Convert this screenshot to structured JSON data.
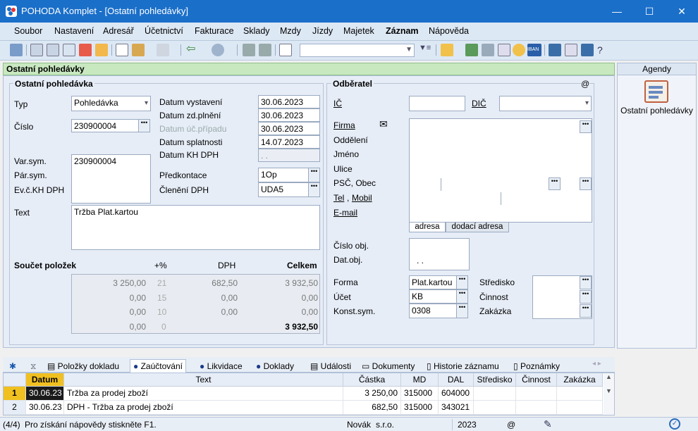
{
  "window": {
    "title": "POHODA Komplet - [Ostatní pohledávky]",
    "minimize": "—",
    "maximize": "☐",
    "close": "✕"
  },
  "menu": [
    "Soubor",
    "Nastavení",
    "Adresář",
    "Účetnictví",
    "Fakturace",
    "Sklady",
    "Mzdy",
    "Jízdy",
    "Majetek",
    "Záznam",
    "Nápověda"
  ],
  "form": {
    "header": "Ostatní pohledávky",
    "section_left": "Ostatní pohledávka",
    "typ_label": "Typ",
    "typ_value": "Pohledávka",
    "cislo_label": "Číslo",
    "cislo_value": "230900004",
    "varsym_label": "Var.sym.",
    "varsym_value": "230900004",
    "parsym_label": "Pár.sym.",
    "evc_label": "Ev.č.KH DPH",
    "text_label": "Text",
    "text_value": "Tržba Plat.kartou",
    "datum_vystaveni_label": "Datum vystavení",
    "datum_vystaveni": "30.06.2023",
    "datum_zdplneni_label": "Datum zd.plnění",
    "datum_zdplneni": "30.06.2023",
    "datum_ucpripadu_label": "Datum úč.případu",
    "datum_ucpripadu": "30.06.2023",
    "datum_splatnosti_label": "Datum splatnosti",
    "datum_splatnosti": "14.07.2023",
    "datum_khdph_label": "Datum KH DPH",
    "datum_khdph": ". .",
    "predkontace_label": "Předkontace",
    "predkontace": "1Op",
    "cleneni_label": "Členění DPH",
    "cleneni": "UDA5",
    "soucet_label": "Součet položek",
    "col_pct": "+%",
    "col_dph": "DPH",
    "col_celkem": "Celkem",
    "rows": [
      {
        "zaklad": "3 250,00",
        "pct": "21",
        "dph": "682,50",
        "celkem": "3 932,50"
      },
      {
        "zaklad": "0,00",
        "pct": "15",
        "dph": "0,00",
        "celkem": "0,00"
      },
      {
        "zaklad": "0,00",
        "pct": "10",
        "dph": "0,00",
        "celkem": "0,00"
      },
      {
        "zaklad": "0,00",
        "pct": "0",
        "dph": "",
        "celkem": "3 932,50"
      }
    ],
    "section_right": "Odběratel",
    "at": "@",
    "ic_label": "IČ",
    "dic_label": "DIČ",
    "firma_label": "Firma",
    "oddeleni_label": "Oddělení",
    "jmeno_label": "Jméno",
    "ulice_label": "Ulice",
    "psc_label": "PSČ, Obec",
    "tel_label": "Tel",
    "mobil_label": "Mobil",
    "email_label": "E-mail",
    "tab_adresa": "adresa",
    "tab_dodaci": "dodací adresa",
    "cisloobj_label": "Číslo obj.",
    "datobj_label": "Dat.obj.",
    "datobj_value": ". .",
    "forma_label": "Forma",
    "forma_value": "Plat.kartou",
    "ucet_label": "Účet",
    "ucet_value": "KB",
    "konst_label": "Konst.sym.",
    "konst_value": "0308",
    "stredisko_label": "Středisko",
    "cinnost_label": "Činnost",
    "zakazka_label": "Zakázka"
  },
  "agenda": {
    "title": "Agendy",
    "item": "Ostatní pohledávky"
  },
  "tabs": [
    "Položky dokladu",
    "Zaúčtování",
    "Likvidace",
    "Doklady",
    "Události",
    "Dokumenty",
    "Historie záznamu",
    "Poznámky"
  ],
  "tabs_symbols": {
    "star": "✱"
  },
  "grid": {
    "headers": [
      "Datum",
      "Text",
      "Částka",
      "MD",
      "DAL",
      "Středisko",
      "Činnost",
      "Zakázka"
    ],
    "rows": [
      {
        "n": "1",
        "datum": "30.06.23",
        "text": "Tržba za prodej zboží",
        "castka": "3 250,00",
        "md": "315000",
        "dal": "604000"
      },
      {
        "n": "2",
        "datum": "30.06.23",
        "text": "DPH - Tržba za prodej zboží",
        "castka": "682,50",
        "md": "315000",
        "dal": "343021"
      }
    ]
  },
  "status": {
    "count": "(4/4)",
    "help": "Pro získání nápovědy stiskněte F1.",
    "user": "Novák",
    "company": "s.r.o.",
    "year": "2023",
    "at": "@"
  }
}
